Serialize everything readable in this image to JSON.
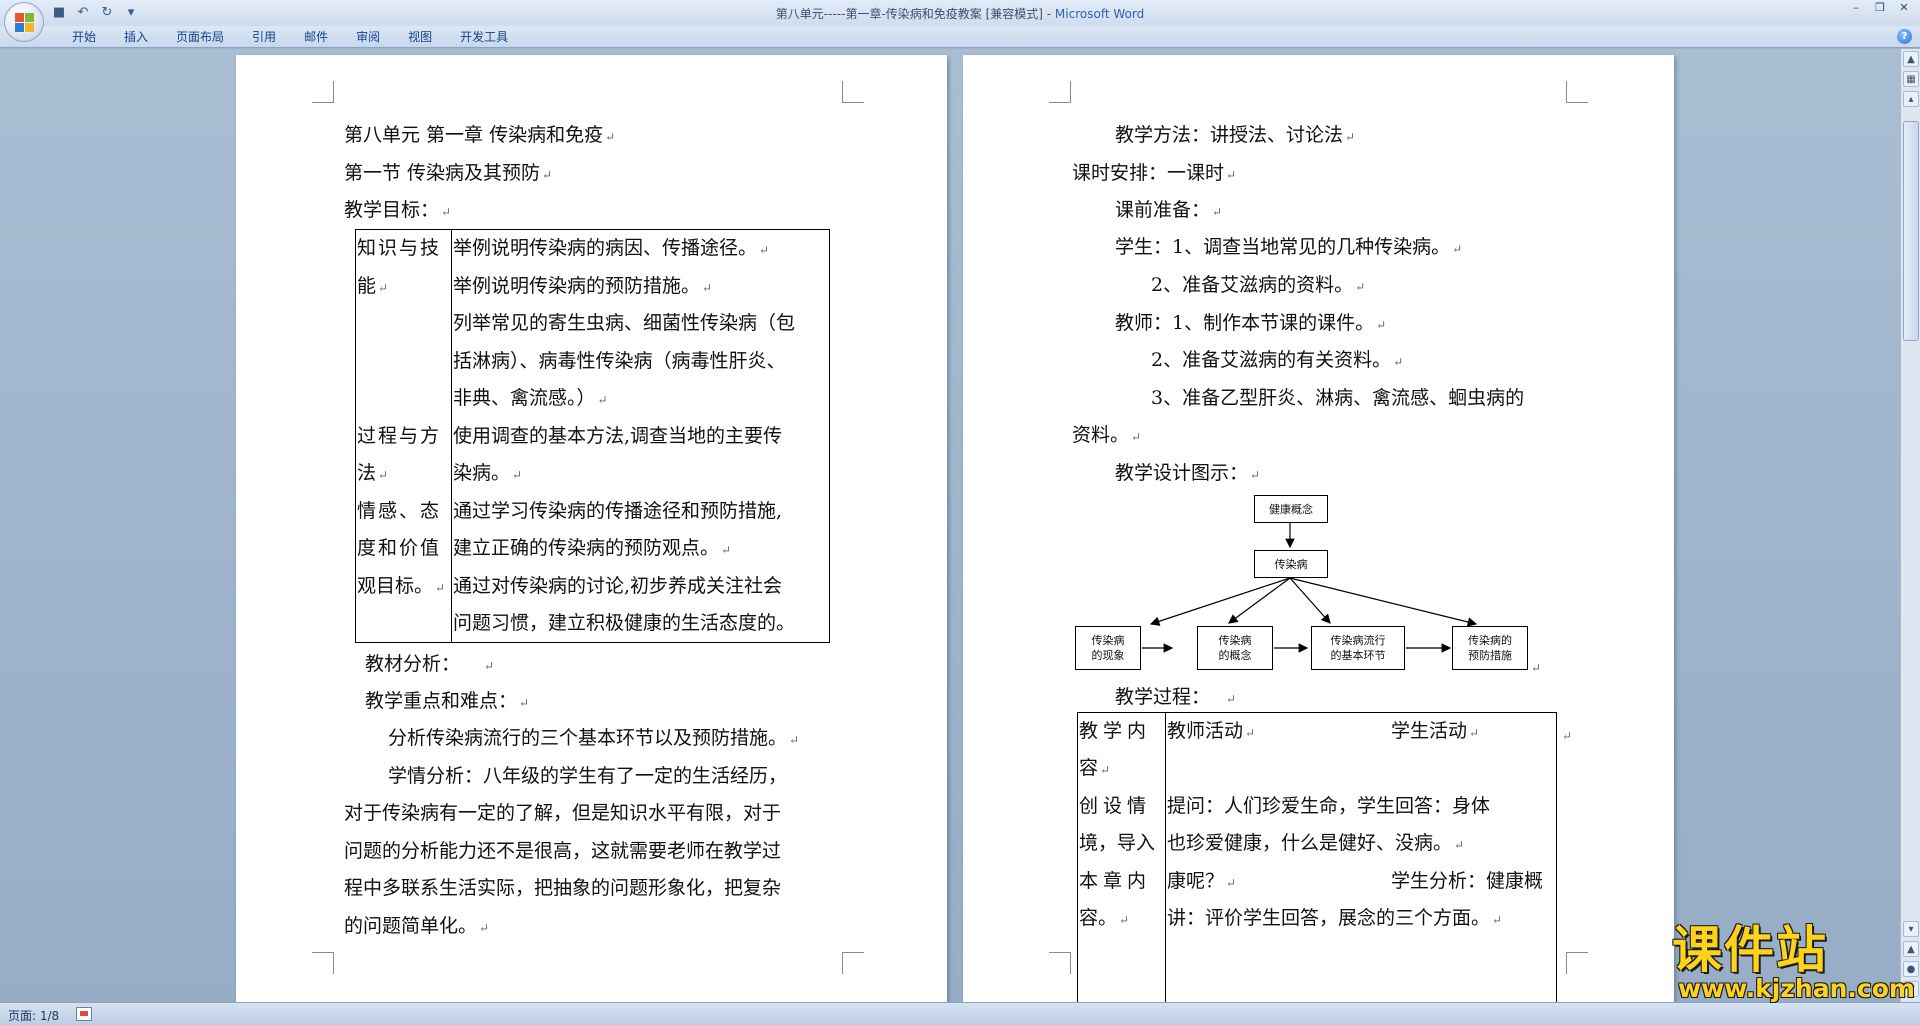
{
  "window": {
    "title_main": "第八单元-----第一章-传染病和免疫教案 [兼容模式] - ",
    "title_app": "Microsoft Word",
    "qat": [
      "save-icon",
      "undo-icon",
      "redo-icon",
      "customize-icon"
    ],
    "controls": [
      "minimize-icon",
      "restore-icon",
      "close-icon"
    ]
  },
  "ribbon": {
    "tabs": [
      "开始",
      "插入",
      "页面布局",
      "引用",
      "邮件",
      "审阅",
      "视图",
      "开发工具"
    ],
    "help": "?"
  },
  "page1": {
    "l1": "第八单元        第一章  传染病和免疫",
    "l2": "第一节  传染病及其预防",
    "l3": "教学目标：",
    "table": {
      "cat1_a": "知识与技",
      "cat1_b": "能",
      "cat2_a": "过程与方",
      "cat2_b": "法",
      "cat3_a": "情感、态",
      "cat3_b": "度和价值",
      "cat3_c": "观目标。",
      "r1": "举例说明传染病的病因、传播途径。",
      "r2": "举例说明传染病的预防措施。",
      "r3": "列举常见的寄生虫病、细菌性传染病（包",
      "r4": "括淋病）、病毒性传染病（病毒性肝炎、",
      "r5": "非典、禽流感。）",
      "r6": "使用调查的基本方法,调查当地的主要传",
      "r7": "染病。",
      "r8": "通过学习传染病的传播途径和预防措施,",
      "r9": "建立正确的传染病的预防观点。",
      "r10": "通过对传染病的讨论,初步养成关注社会",
      "r11": "问题习惯，建立积极健康的生活态度的。"
    },
    "l4": "教材分析：",
    "l5": "教学重点和难点：",
    "l6": "分析传染病流行的三个基本环节以及预防措施。",
    "l7": "学情分析：八年级的学生有了一定的生活经历，",
    "l8": "对于传染病有一定的了解，但是知识水平有限，对于",
    "l9": "问题的分析能力还不是很高，这就需要老师在教学过",
    "l10": "程中多联系生活实际，把抽象的问题形象化，把复杂",
    "l11": "的问题简单化。"
  },
  "page2": {
    "l1": "教学方法：讲授法、讨论法",
    "l2": "课时安排：一课时",
    "l3": "课前准备：",
    "l4": "学生：1、调查当地常见的几种传染病。",
    "l5": "2、准备艾滋病的资料。",
    "l6": "教师：1、制作本节课的课件。",
    "l7": "2、准备艾滋病的有关资料。",
    "l8": "3、准备乙型肝炎、淋病、禽流感、蛔虫病的",
    "l9": "资料。",
    "l10": "教学设计图示：",
    "diagram": {
      "top": "健康概念",
      "mid": "传染病",
      "b1_a": "传染病",
      "b1_b": "的现象",
      "b2_a": "传染病",
      "b2_b": "的概念",
      "b3_a": "传染病流行",
      "b3_b": "的基本环节",
      "b4_a": "传染病的",
      "b4_b": "预防措施"
    },
    "l11": "教学过程：",
    "table": {
      "c1_a": "教学内",
      "c1_b": "容",
      "h_teacher": "教师活动",
      "h_student": "学生活动",
      "c2_a": "创设情",
      "c2_b": "境，导入",
      "c2_c": "本章内",
      "c2_d": "容。",
      "t1": "提问：人们珍爱生命，学生回答：身体",
      "t2": "也珍爱健康，什么是健好、没病。",
      "t3": "康呢？",
      "t3_s": "学生分析：健康概",
      "t4": "讲：评价学生回答，展念的三个方面。"
    }
  },
  "status": {
    "page": "页面: 1/8"
  },
  "watermark": {
    "cn": "课件站",
    "url": "www.kjzhan.com"
  }
}
